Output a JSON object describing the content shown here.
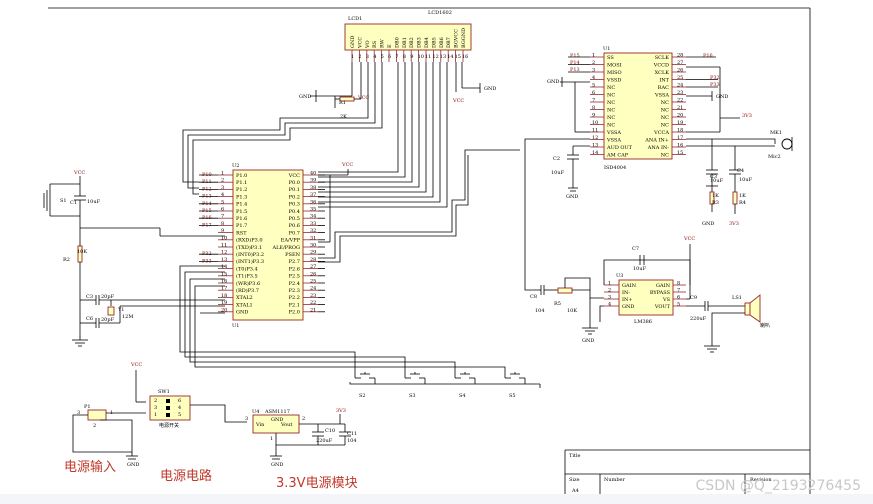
{
  "lcd": {
    "ref": "LCD1",
    "part": "LCD1602",
    "pins": [
      "GND",
      "VCC",
      "VO",
      "RS",
      "RW",
      "E",
      "DB0",
      "DB1",
      "DB2",
      "DB3",
      "DB4",
      "DB5",
      "DB6",
      "DB7",
      "BGVCC",
      "BGGND"
    ],
    "pin_numbers": [
      "1",
      "2",
      "3",
      "4",
      "5",
      "6",
      "7",
      "8",
      "9",
      "10",
      "11",
      "12",
      "13",
      "14",
      "15",
      "16"
    ]
  },
  "mcu": {
    "ref": "U2",
    "ref_bottom": "U1",
    "left_pins": [
      "P1.0",
      "P1.1",
      "P1.2",
      "P1.3",
      "P1.4",
      "P1.5",
      "P1.6",
      "P1.7",
      "RST",
      "(RXD)P3.0",
      "(TXD)P3.1",
      "(INT0)P3.2",
      "(INT1)P3.3",
      "(T0)P3.4",
      "(T1)P3.5",
      "(WR)P3.6",
      "(RD)P3.7",
      "XTAL2",
      "XTAL1",
      "GND"
    ],
    "left_numbers": [
      "1",
      "2",
      "3",
      "4",
      "5",
      "6",
      "7",
      "8",
      "9",
      "10",
      "11",
      "12",
      "13",
      "14",
      "15",
      "16",
      "17",
      "18",
      "19",
      "20"
    ],
    "right_pins": [
      "VCC",
      "P0.0",
      "P0.1",
      "P0.2",
      "P0.3",
      "P0.4",
      "P0.5",
      "P0.6",
      "P0.7",
      "EA/VPP",
      "ALE/PROG",
      "PSEN",
      "P2.7",
      "P2.6",
      "P2.5",
      "P2.4",
      "P2.3",
      "P2.2",
      "P2.1",
      "P2.0"
    ],
    "right_numbers": [
      "40",
      "39",
      "38",
      "37",
      "36",
      "35",
      "34",
      "33",
      "32",
      "31",
      "30",
      "29",
      "28",
      "27",
      "26",
      "25",
      "24",
      "23",
      "22",
      "21"
    ],
    "left_nets": [
      "P10",
      "P11",
      "P12",
      "P13",
      "P14",
      "P15",
      "P16",
      "P17"
    ],
    "p3_nets": [
      "P32",
      "P33"
    ]
  },
  "isd": {
    "ref": "U1",
    "part": "ISD4004",
    "left_pins": [
      "SS",
      "MOSI",
      "MISO",
      "VSSD",
      "NC",
      "NC",
      "NC",
      "NC",
      "NC",
      "NC",
      "VSSA",
      "VSSA",
      "AUD OUT",
      "AM CAP"
    ],
    "left_numbers": [
      "1",
      "2",
      "3",
      "4",
      "5",
      "6",
      "7",
      "8",
      "9",
      "10",
      "11",
      "12",
      "13",
      "14"
    ],
    "right_pins": [
      "SCLK",
      "VCCD",
      "XCLK",
      "INT",
      "RAC",
      "VSSA",
      "NC",
      "NC",
      "NC",
      "NC",
      "VCCA",
      "ANA IN+",
      "ANA IN-",
      "NC"
    ],
    "right_numbers": [
      "28",
      "27",
      "26",
      "25",
      "24",
      "23",
      "22",
      "21",
      "20",
      "19",
      "18",
      "17",
      "16",
      "15"
    ],
    "nets": [
      "P15",
      "P14",
      "P13",
      "P16",
      "P32",
      "P33"
    ]
  },
  "amp": {
    "ref": "U3",
    "part": "LM386",
    "left_pins": [
      "GAIN",
      "IN-",
      "IN+",
      "GND"
    ],
    "left_numbers": [
      "1",
      "2",
      "3",
      "4"
    ],
    "right_pins": [
      "GAIN",
      "BYPASS",
      "VS",
      "VOUT"
    ],
    "right_numbers": [
      "8",
      "7",
      "6",
      "5"
    ]
  },
  "reg": {
    "ref": "U4",
    "part": "ASM1117",
    "pins": [
      "Vin",
      "GND",
      "Vout"
    ],
    "pin_numbers": [
      "3",
      "1",
      "2"
    ]
  },
  "switch": {
    "ref": "SW1",
    "label": "电源开关",
    "pins": [
      "2",
      "1",
      "5",
      "4",
      "3",
      "6"
    ]
  },
  "connector": {
    "ref": "P1",
    "pins": [
      "1",
      "2",
      "3"
    ]
  },
  "parts": {
    "c1": "C1",
    "c1_val": "10uF",
    "c2": "C2",
    "c2_val": "10uF",
    "c3": "C3",
    "c3_val": "20pF",
    "c4": "C4",
    "c4_val": "10uF",
    "c5": "C5",
    "c5_val": "10uF",
    "c6": "C6",
    "c6_val": "20pF",
    "c7": "C7",
    "c7_val": "10uF",
    "c8": "C8",
    "c8_val": "104",
    "c9": "C9",
    "c9_val": "220uF",
    "c10": "C10",
    "c10_val": "220uF",
    "c11": "C11",
    "c11_val": "104",
    "r1": "R1",
    "r1_val": "2K",
    "r2": "R2",
    "r2_val": "10K",
    "r3": "R3",
    "r3_val": "1K",
    "r4": "R4",
    "r4_val": "1K",
    "r5": "R5",
    "r5_val": "10K",
    "y1": "Y1",
    "y1_val": "12M",
    "s1": "S1",
    "mic": "MK1",
    "mic_name": "Mic2",
    "spk": "LS1",
    "spk_name": "喇叭",
    "keys": [
      "S2",
      "S3",
      "S4",
      "S5"
    ]
  },
  "nets": {
    "vcc": "VCC",
    "gnd": "GND",
    "v33": "3V3",
    "v33_alt": "3.3V"
  },
  "captions": {
    "power_in": "电源输入",
    "power_circuit": "电源电路",
    "module": "3.3V电源模块"
  },
  "title_block": {
    "title": "Title",
    "size": "Size",
    "size_val": "A4",
    "number": "Number",
    "revision": "Revision"
  },
  "watermark": "CSDN @Q_2193276455"
}
